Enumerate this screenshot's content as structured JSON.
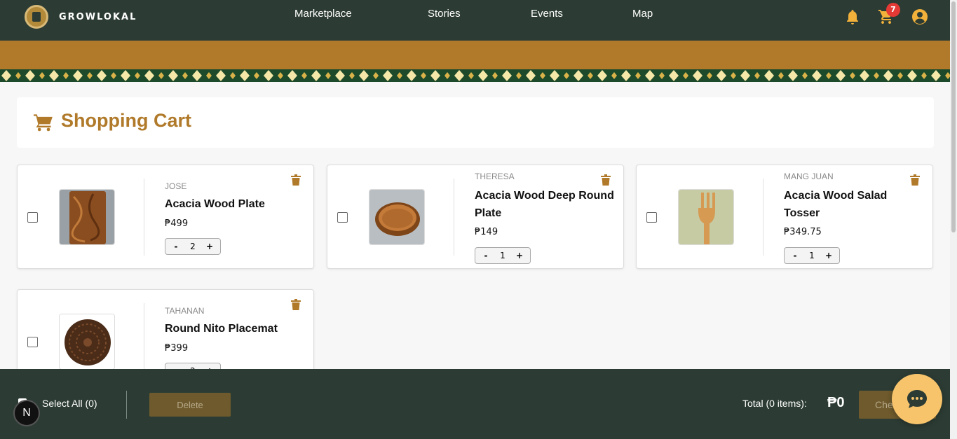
{
  "app": {
    "brand": "GROWLOKAL",
    "cart_count": "7"
  },
  "nav": {
    "items": [
      "Marketplace",
      "Stories",
      "Events",
      "Map"
    ]
  },
  "page": {
    "title": "Shopping Cart"
  },
  "cart_items": [
    {
      "seller": "JOSE",
      "name": "Acacia Wood Plate",
      "price": "₱499",
      "qty": "2"
    },
    {
      "seller": "THERESA",
      "name": "Acacia Wood Deep Round Plate",
      "price": "₱149",
      "qty": "1"
    },
    {
      "seller": "MANG JUAN",
      "name": "Acacia Wood Salad Tosser",
      "price": "₱349.75",
      "qty": "1"
    },
    {
      "seller": "TAHANAN",
      "name": "Round Nito Placemat",
      "price": "₱399",
      "qty": "2"
    }
  ],
  "qty_controls": {
    "minus": "-",
    "plus": "+"
  },
  "footer": {
    "select_all": "Select All (0)",
    "delete_label": "Delete",
    "total_label": "Total (0 items):",
    "total_value": "₱0",
    "checkout_label": "Checkout"
  },
  "dev": {
    "next_badge": "N"
  },
  "colors": {
    "header": "#2c3c34",
    "accent": "#b07a2a",
    "chat": "#f7c46c"
  }
}
